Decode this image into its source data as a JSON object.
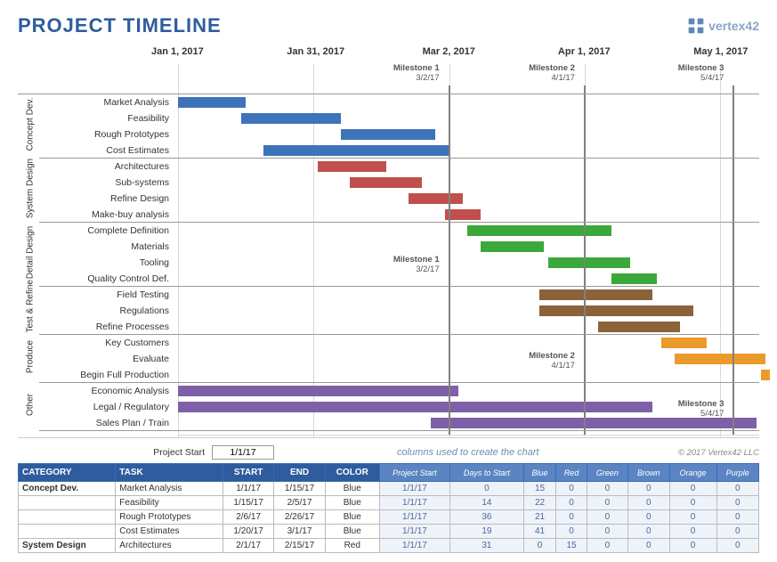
{
  "header": {
    "title": "PROJECT TIMELINE",
    "logo_text": "vertex42"
  },
  "chart": {
    "start_epoch_days": 0,
    "span_days": 130,
    "date_labels": [
      {
        "text": "Jan 1, 2017",
        "day": 0
      },
      {
        "text": "Jan 31, 2017",
        "day": 30
      },
      {
        "text": "Mar 2, 2017",
        "day": 60
      },
      {
        "text": "Apr 1, 2017",
        "day": 90
      },
      {
        "text": "May 1, 2017",
        "day": 120
      }
    ],
    "milestones": [
      {
        "label": "Milestone 1",
        "date": "3/2/17",
        "day": 60,
        "top_row_start": 0,
        "block_row": 10,
        "label_row": 10
      },
      {
        "label": "Milestone 2",
        "date": "4/1/17",
        "day": 90,
        "top_row_start": 0,
        "block_row": 16,
        "label_row": 16
      },
      {
        "label": "Milestone 3",
        "date": "5/4/17",
        "day": 123,
        "top_row_start": 0,
        "block_row": 19,
        "label_row": 19
      }
    ],
    "groups": [
      {
        "name": "Concept Dev.",
        "short": "Concept\nDev.",
        "rows": [
          "Market Analysis",
          "Feasibility",
          "Rough Prototypes",
          "Cost Estimates"
        ]
      },
      {
        "name": "System Design",
        "short": "System\nDesign",
        "rows": [
          "Architectures",
          "Sub-systems",
          "Refine Design",
          "Make-buy analysis"
        ]
      },
      {
        "name": "Detail Design",
        "short": "Detail\nDesign",
        "rows": [
          "Complete Definition",
          "Materials",
          "Tooling",
          "Quality Control Def."
        ]
      },
      {
        "name": "Test & Refine",
        "short": "Test &\nRefine",
        "rows": [
          "Field Testing",
          "Regulations",
          "Refine Processes"
        ]
      },
      {
        "name": "Produce",
        "short": "Produce",
        "rows": [
          "Key Customers",
          "Evaluate",
          "Begin Full Production"
        ]
      },
      {
        "name": "Other",
        "short": "Other",
        "rows": [
          "Economic Analysis",
          "Legal / Regulatory",
          "Sales Plan / Train"
        ]
      }
    ],
    "bars": [
      {
        "row": 0,
        "start": 0,
        "dur": 15,
        "color": "#3e73b8"
      },
      {
        "row": 1,
        "start": 14,
        "dur": 22,
        "color": "#3e73b8"
      },
      {
        "row": 2,
        "start": 36,
        "dur": 21,
        "color": "#3e73b8"
      },
      {
        "row": 3,
        "start": 19,
        "dur": 41,
        "color": "#3e73b8"
      },
      {
        "row": 4,
        "start": 31,
        "dur": 15,
        "color": "#c0504d"
      },
      {
        "row": 5,
        "start": 38,
        "dur": 16,
        "color": "#c0504d"
      },
      {
        "row": 6,
        "start": 51,
        "dur": 12,
        "color": "#c0504d"
      },
      {
        "row": 7,
        "start": 59,
        "dur": 8,
        "color": "#c0504d"
      },
      {
        "row": 8,
        "start": 64,
        "dur": 32,
        "color": "#3ba83b"
      },
      {
        "row": 9,
        "start": 67,
        "dur": 14,
        "color": "#3ba83b"
      },
      {
        "row": 10,
        "start": 82,
        "dur": 18,
        "color": "#3ba83b"
      },
      {
        "row": 11,
        "start": 96,
        "dur": 10,
        "color": "#3ba83b"
      },
      {
        "row": 12,
        "start": 80,
        "dur": 25,
        "color": "#8c6239"
      },
      {
        "row": 13,
        "start": 80,
        "dur": 34,
        "color": "#8c6239"
      },
      {
        "row": 14,
        "start": 93,
        "dur": 18,
        "color": "#8c6239"
      },
      {
        "row": 15,
        "start": 107,
        "dur": 10,
        "color": "#ed9a2d"
      },
      {
        "row": 16,
        "start": 110,
        "dur": 20,
        "color": "#ed9a2d"
      },
      {
        "row": 17,
        "start": 129,
        "dur": 2,
        "color": "#ed9a2d"
      },
      {
        "row": 18,
        "start": 0,
        "dur": 62,
        "color": "#7e60a8"
      },
      {
        "row": 19,
        "start": 0,
        "dur": 105,
        "color": "#7e60a8"
      },
      {
        "row": 20,
        "start": 56,
        "dur": 72,
        "color": "#7e60a8"
      }
    ]
  },
  "meta": {
    "project_start_label": "Project Start",
    "project_start_value": "1/1/17",
    "columns_hint": "columns used to create the chart",
    "copyright": "© 2017 Vertex42 LLC"
  },
  "table": {
    "headers_main": [
      "CATEGORY",
      "TASK",
      "START",
      "END",
      "COLOR"
    ],
    "headers_sub": [
      "Project Start",
      "Days to Start",
      "Blue",
      "Red",
      "Green",
      "Brown",
      "Orange",
      "Purple"
    ],
    "rows": [
      {
        "cat": "Concept Dev.",
        "task": "Market Analysis",
        "start": "1/1/17",
        "end": "1/15/17",
        "color": "Blue",
        "sub": [
          "1/1/17",
          "0",
          "15",
          "0",
          "0",
          "0",
          "0",
          "0"
        ]
      },
      {
        "cat": "",
        "task": "Feasibility",
        "start": "1/15/17",
        "end": "2/5/17",
        "color": "Blue",
        "sub": [
          "1/1/17",
          "14",
          "22",
          "0",
          "0",
          "0",
          "0",
          "0"
        ]
      },
      {
        "cat": "",
        "task": "Rough Prototypes",
        "start": "2/6/17",
        "end": "2/26/17",
        "color": "Blue",
        "sub": [
          "1/1/17",
          "36",
          "21",
          "0",
          "0",
          "0",
          "0",
          "0"
        ]
      },
      {
        "cat": "",
        "task": "Cost Estimates",
        "start": "1/20/17",
        "end": "3/1/17",
        "color": "Blue",
        "sub": [
          "1/1/17",
          "19",
          "41",
          "0",
          "0",
          "0",
          "0",
          "0"
        ]
      },
      {
        "cat": "System Design",
        "task": "Architectures",
        "start": "2/1/17",
        "end": "2/15/17",
        "color": "Red",
        "sub": [
          "1/1/17",
          "31",
          "0",
          "15",
          "0",
          "0",
          "0",
          "0"
        ]
      }
    ]
  },
  "chart_data": {
    "type": "bar",
    "orientation": "horizontal-gantt",
    "title": "PROJECT TIMELINE",
    "x_axis": {
      "start": "2017-01-01",
      "end": "2017-05-11",
      "ticks": [
        "Jan 1, 2017",
        "Jan 31, 2017",
        "Mar 2, 2017",
        "Apr 1, 2017",
        "May 1, 2017"
      ]
    },
    "milestones": [
      {
        "name": "Milestone 1",
        "date": "2017-03-02"
      },
      {
        "name": "Milestone 2",
        "date": "2017-04-01"
      },
      {
        "name": "Milestone 3",
        "date": "2017-05-04"
      }
    ],
    "series": [
      {
        "category": "Concept Dev.",
        "task": "Market Analysis",
        "start": "2017-01-01",
        "end": "2017-01-15",
        "color": "Blue"
      },
      {
        "category": "Concept Dev.",
        "task": "Feasibility",
        "start": "2017-01-15",
        "end": "2017-02-05",
        "color": "Blue"
      },
      {
        "category": "Concept Dev.",
        "task": "Rough Prototypes",
        "start": "2017-02-06",
        "end": "2017-02-26",
        "color": "Blue"
      },
      {
        "category": "Concept Dev.",
        "task": "Cost Estimates",
        "start": "2017-01-20",
        "end": "2017-03-01",
        "color": "Blue"
      },
      {
        "category": "System Design",
        "task": "Architectures",
        "start": "2017-02-01",
        "end": "2017-02-15",
        "color": "Red"
      },
      {
        "category": "System Design",
        "task": "Sub-systems",
        "start": "2017-02-08",
        "end": "2017-02-24",
        "color": "Red"
      },
      {
        "category": "System Design",
        "task": "Refine Design",
        "start": "2017-02-21",
        "end": "2017-03-05",
        "color": "Red"
      },
      {
        "category": "System Design",
        "task": "Make-buy analysis",
        "start": "2017-03-01",
        "end": "2017-03-09",
        "color": "Red"
      },
      {
        "category": "Detail Design",
        "task": "Complete Definition",
        "start": "2017-03-06",
        "end": "2017-04-07",
        "color": "Green"
      },
      {
        "category": "Detail Design",
        "task": "Materials",
        "start": "2017-03-09",
        "end": "2017-03-23",
        "color": "Green"
      },
      {
        "category": "Detail Design",
        "task": "Tooling",
        "start": "2017-03-24",
        "end": "2017-04-11",
        "color": "Green"
      },
      {
        "category": "Detail Design",
        "task": "Quality Control Def.",
        "start": "2017-04-07",
        "end": "2017-04-17",
        "color": "Green"
      },
      {
        "category": "Test & Refine",
        "task": "Field Testing",
        "start": "2017-03-22",
        "end": "2017-04-16",
        "color": "Brown"
      },
      {
        "category": "Test & Refine",
        "task": "Regulations",
        "start": "2017-03-22",
        "end": "2017-04-25",
        "color": "Brown"
      },
      {
        "category": "Test & Refine",
        "task": "Refine Processes",
        "start": "2017-04-04",
        "end": "2017-04-22",
        "color": "Brown"
      },
      {
        "category": "Produce",
        "task": "Key Customers",
        "start": "2017-04-18",
        "end": "2017-04-28",
        "color": "Orange"
      },
      {
        "category": "Produce",
        "task": "Evaluate",
        "start": "2017-04-21",
        "end": "2017-05-11",
        "color": "Orange"
      },
      {
        "category": "Produce",
        "task": "Begin Full Production",
        "start": "2017-05-10",
        "end": "2017-05-12",
        "color": "Orange"
      },
      {
        "category": "Other",
        "task": "Economic Analysis",
        "start": "2017-01-01",
        "end": "2017-03-04",
        "color": "Purple"
      },
      {
        "category": "Other",
        "task": "Legal / Regulatory",
        "start": "2017-01-01",
        "end": "2017-04-16",
        "color": "Purple"
      },
      {
        "category": "Other",
        "task": "Sales Plan / Train",
        "start": "2017-02-26",
        "end": "2017-05-09",
        "color": "Purple"
      }
    ]
  }
}
